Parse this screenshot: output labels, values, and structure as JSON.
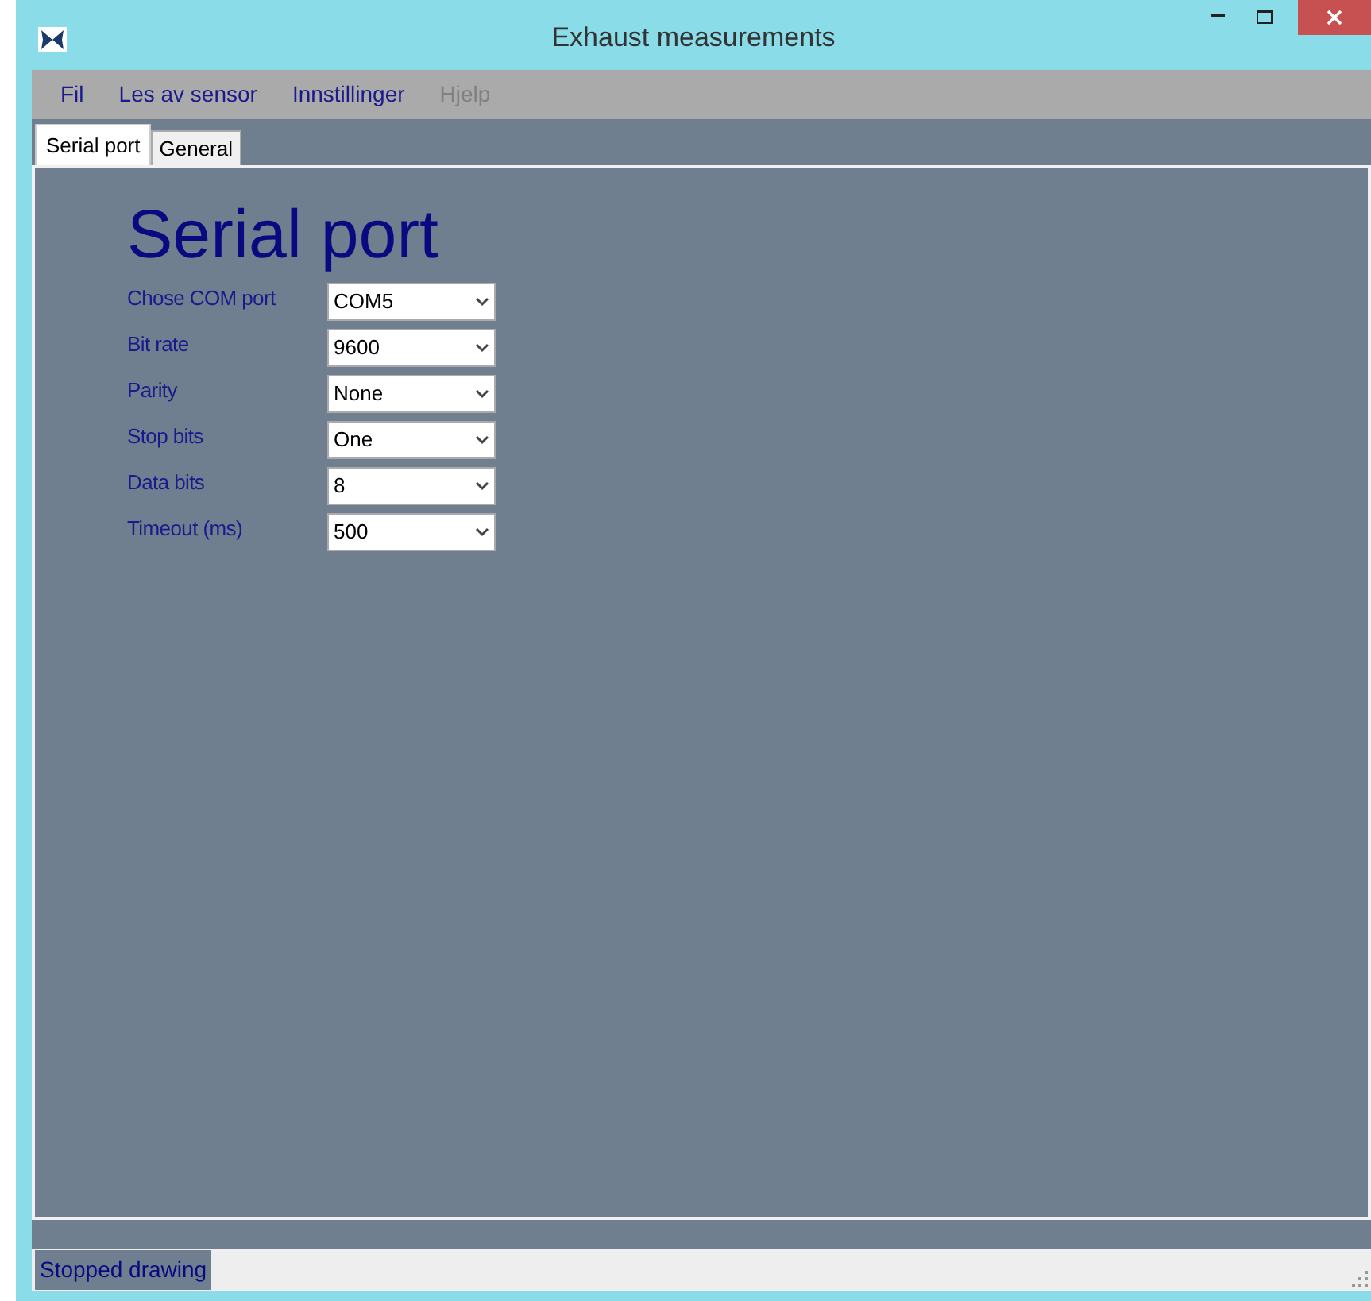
{
  "window": {
    "title": "Exhaust measurements"
  },
  "menu": [
    {
      "label": "Fil",
      "disabled": false
    },
    {
      "label": "Les av sensor",
      "disabled": false
    },
    {
      "label": "Innstillinger",
      "disabled": false
    },
    {
      "label": "Hjelp",
      "disabled": true
    }
  ],
  "tabs": [
    {
      "label": "Serial port",
      "selected": true
    },
    {
      "label": "General",
      "selected": false
    }
  ],
  "heading": "Serial port",
  "settings": [
    {
      "label": "Chose COM port",
      "value": "COM5"
    },
    {
      "label": "Bit rate",
      "value": "9600"
    },
    {
      "label": "Parity",
      "value": "None"
    },
    {
      "label": "Stop bits",
      "value": "One"
    },
    {
      "label": "Data bits",
      "value": "8"
    },
    {
      "label": "Timeout (ms)",
      "value": "500"
    }
  ],
  "status_bar": "Stopped drawing"
}
